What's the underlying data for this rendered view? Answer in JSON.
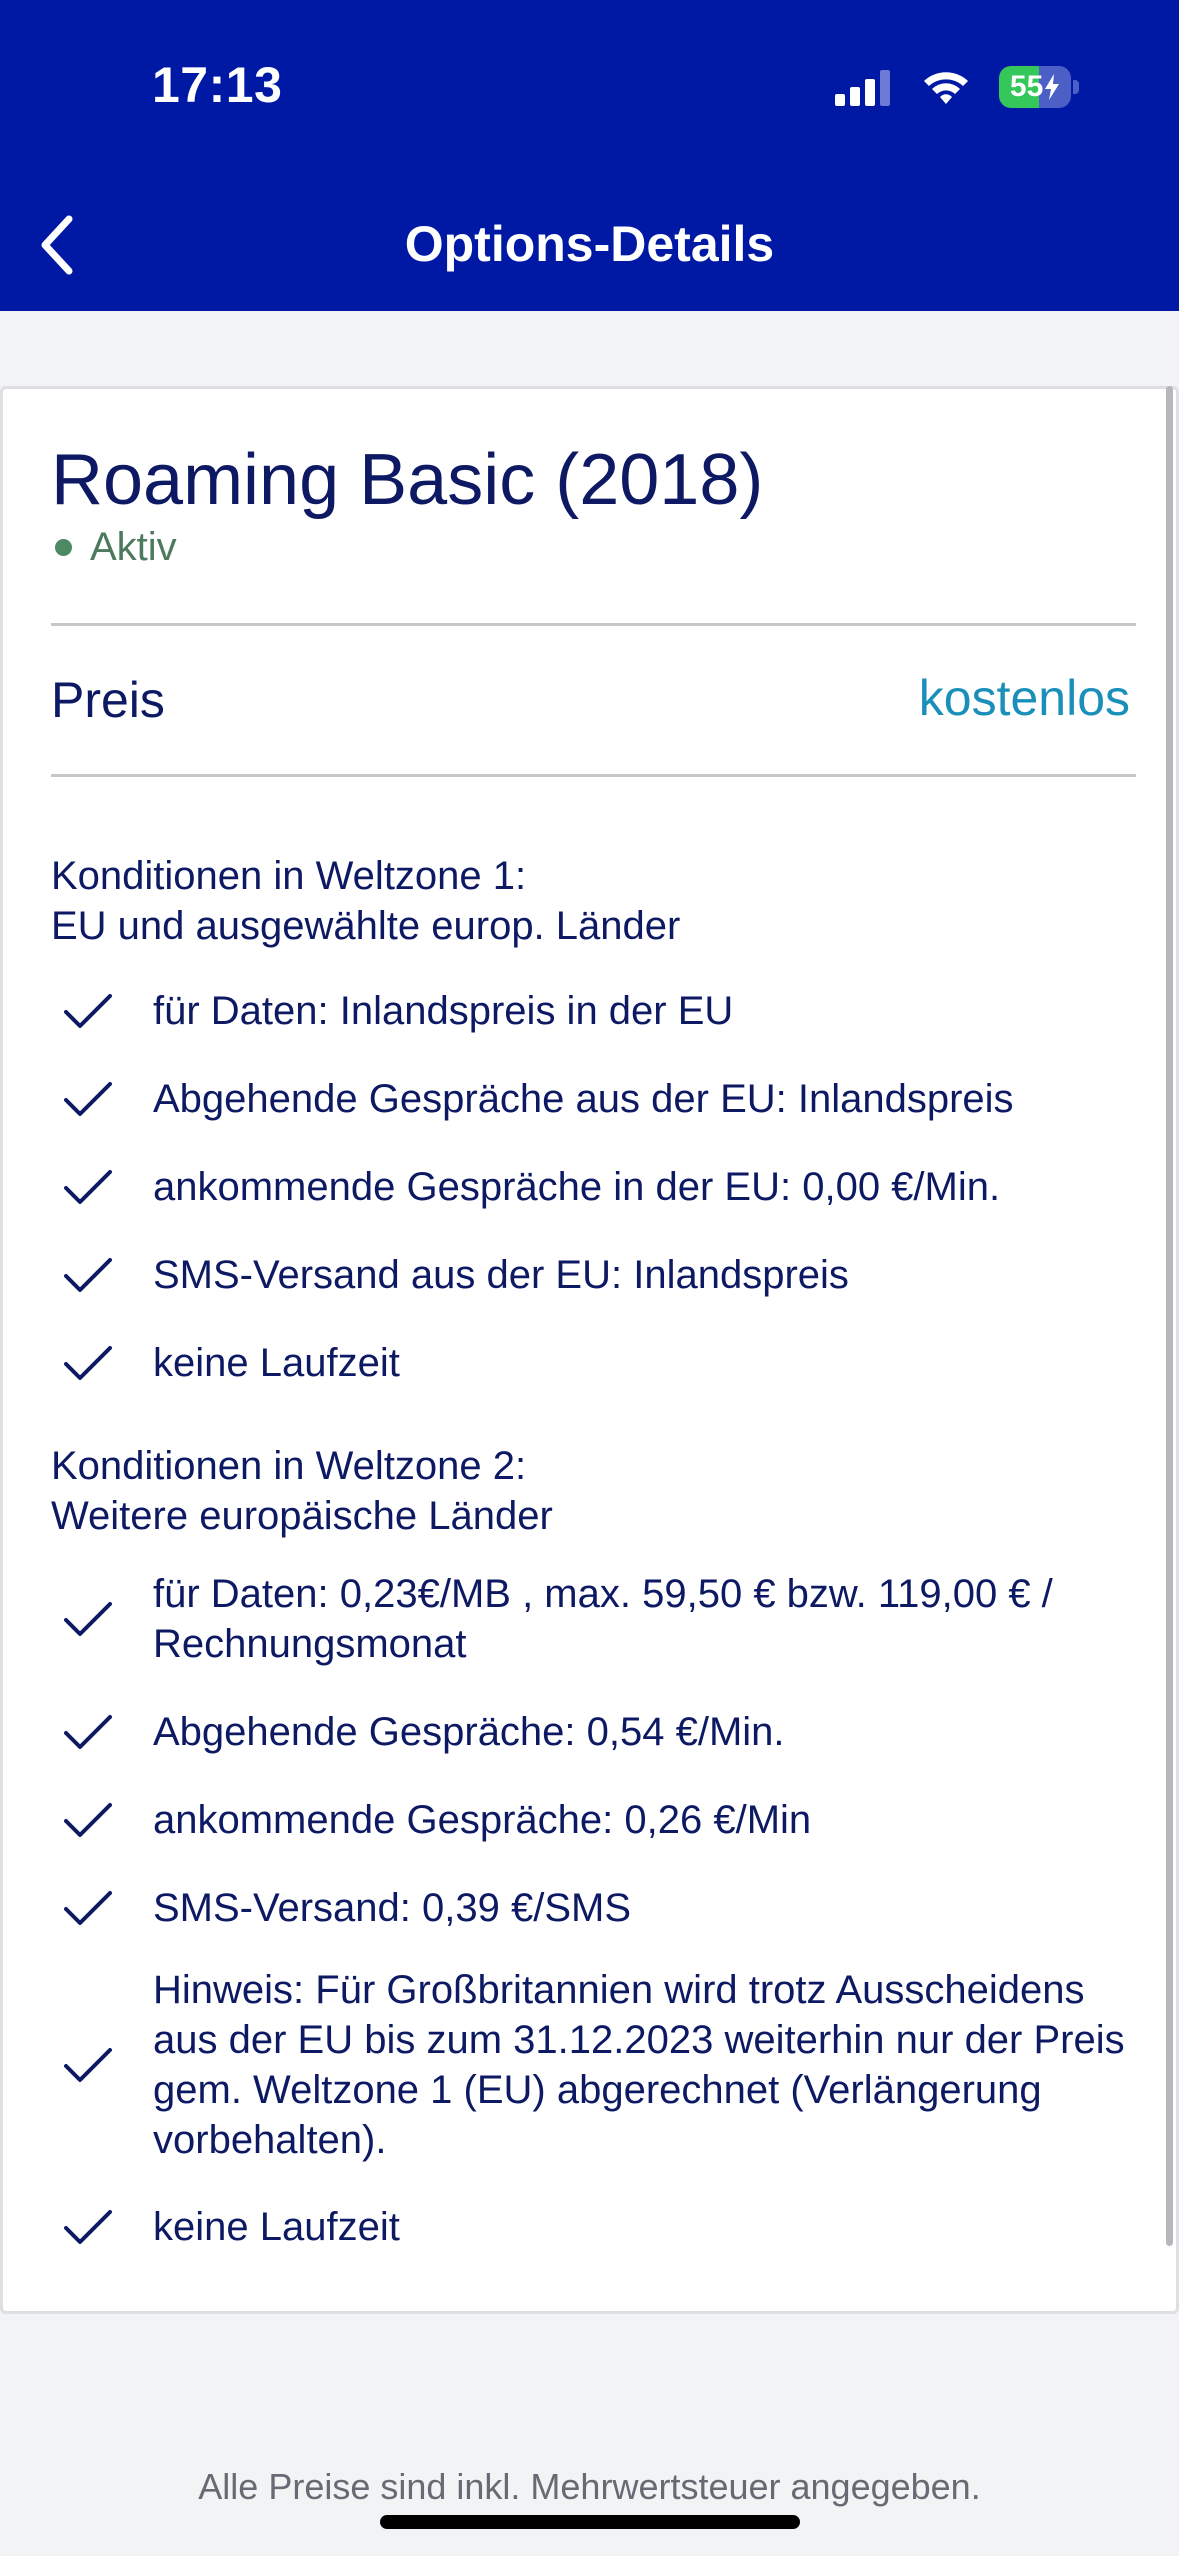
{
  "status_bar": {
    "time": "17:13",
    "battery": "55",
    "battery_level": 0.55,
    "icons": [
      "signal-icon",
      "wifi-icon",
      "battery-charging-icon"
    ]
  },
  "header": {
    "title": "Options-Details",
    "back_icon": "chevron-left-icon",
    "background": "#0019a5"
  },
  "option": {
    "title": "Roaming Basic (2018)",
    "status": "Aktiv",
    "price_label": "Preis",
    "price_value": "kostenlos"
  },
  "zone1": {
    "heading_line1": "Konditionen in Weltzone 1:",
    "heading_line2": "EU und ausgewählte europ. Länder",
    "items": [
      "für Daten: Inlandspreis in der EU",
      "Abgehende Gespräche aus der EU: Inlandspreis",
      "ankommende Gespräche in der EU: 0,00 €/Min.",
      "SMS-Versand aus der EU: Inlandspreis",
      "keine Laufzeit"
    ]
  },
  "zone2": {
    "heading_line1": "Konditionen in Weltzone 2:",
    "heading_line2": "Weitere europäische Länder",
    "items": [
      "für Daten: 0,23€/MB ,  max. 59,50 € bzw. 119,00 € / Rechnungsmonat",
      "Abgehende Gespräche: 0,54 €/Min.",
      "ankommende Gespräche: 0,26 €/Min",
      "SMS-Versand: 0,39 €/SMS",
      "Hinweis: Für Großbritannien wird trotz Ausscheidens aus der EU bis zum 31.12.2023 weiterhin nur der Preis gem. Weltzone 1 (EU) abgerechnet (Verlängerung vorbehalten).",
      "keine Laufzeit"
    ]
  },
  "footer": {
    "note": "Alle Preise sind inkl. Mehrwertsteuer angegeben."
  },
  "colors": {
    "brand": "#0019a5",
    "text_dark": "#0d1a63",
    "active_green": "#4d7a5e",
    "price_blue": "#1a8fba"
  }
}
